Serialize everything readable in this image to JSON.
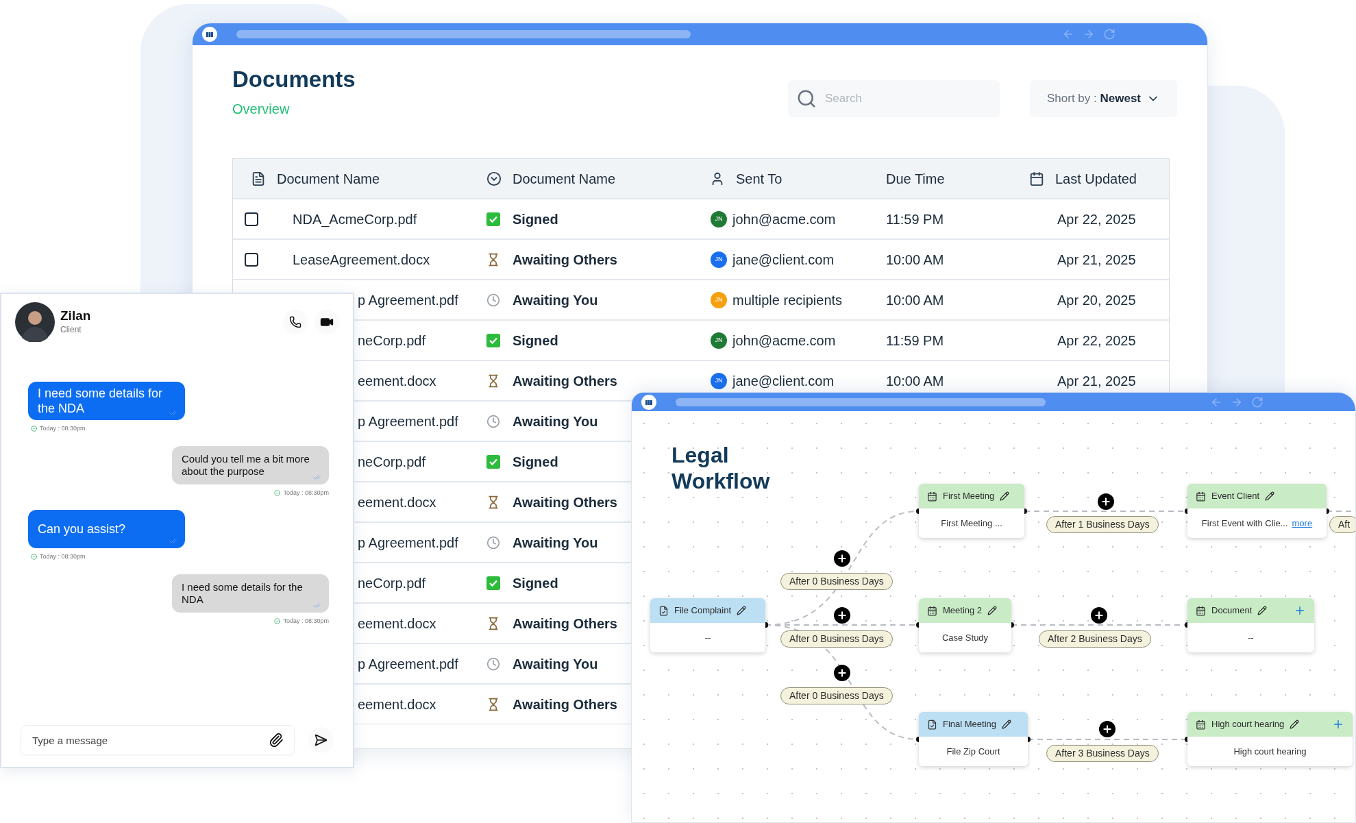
{
  "documents_window": {
    "title": "Documents",
    "subtitle": "Overview",
    "search": {
      "placeholder": "Search"
    },
    "sort": {
      "label": "Short by :",
      "value": "Newest"
    },
    "columns": [
      "Document Name",
      "Document Name",
      "Sent To",
      "Due Time",
      "Last Updated"
    ],
    "rows": [
      {
        "kind": "whole",
        "checked": false,
        "name": "NDA_AcmeCorp.pdf",
        "status": {
          "kind": "signed",
          "label": "Signed"
        },
        "recipient": {
          "initials": "JN",
          "color": "#1f7a35",
          "email": "john@acme.com"
        },
        "due": "11:59 PM",
        "updated": "Apr 22, 2025"
      },
      {
        "kind": "whole",
        "checked": false,
        "name": "LeaseAgreement.docx",
        "status": {
          "kind": "awaiting_others",
          "label": "Awaiting Others"
        },
        "recipient": {
          "initials": "JN",
          "color": "#1a6ff0",
          "email": "jane@client.com"
        },
        "due": "10:00 AM",
        "updated": "Apr 21, 2025"
      },
      {
        "kind": "covered",
        "name": "p Agreement.pdf",
        "status": {
          "kind": "awaiting_you",
          "label": "Awaiting You"
        },
        "recipient": {
          "initials": "JN",
          "color": "#f5a00f",
          "email": "multiple recipients"
        },
        "due": "10:00 AM",
        "updated": "Apr 20, 2025"
      },
      {
        "kind": "covered",
        "name": "neCorp.pdf",
        "status": {
          "kind": "signed",
          "label": "Signed"
        },
        "recipient": {
          "initials": "JN",
          "color": "#1f7a35",
          "email": "john@acme.com"
        },
        "due": "11:59 PM",
        "updated": "Apr 22, 2025"
      },
      {
        "kind": "covered",
        "name": "eement.docx",
        "status": {
          "kind": "awaiting_others",
          "label": "Awaiting Others"
        },
        "recipient": {
          "initials": "JN",
          "color": "#1a6ff0",
          "email": "jane@client.com"
        },
        "due": "10:00 AM",
        "updated": "Apr 21, 2025"
      },
      {
        "kind": "covered",
        "name": "p Agreement.pdf",
        "status": {
          "kind": "awaiting_you",
          "label": "Awaiting You"
        }
      },
      {
        "kind": "covered",
        "name": "neCorp.pdf",
        "status": {
          "kind": "signed",
          "label": "Signed"
        }
      },
      {
        "kind": "covered",
        "name": "eement.docx",
        "status": {
          "kind": "awaiting_others",
          "label": "Awaiting Others"
        }
      },
      {
        "kind": "covered",
        "name": "p Agreement.pdf",
        "status": {
          "kind": "awaiting_you",
          "label": "Awaiting You"
        }
      },
      {
        "kind": "covered",
        "name": "neCorp.pdf",
        "status": {
          "kind": "signed",
          "label": "Signed"
        }
      },
      {
        "kind": "covered",
        "name": "eement.docx",
        "status": {
          "kind": "awaiting_others",
          "label": "Awaiting Others"
        }
      },
      {
        "kind": "covered",
        "name": "p Agreement.pdf",
        "status": {
          "kind": "awaiting_you",
          "label": "Awaiting You"
        }
      },
      {
        "kind": "covered",
        "name": "eement.docx",
        "status": {
          "kind": "awaiting_others",
          "label": "Awaiting Others"
        }
      }
    ]
  },
  "chat": {
    "contact": {
      "name": "Zilan",
      "role": "Client"
    },
    "messages": [
      {
        "kind": "outgoing",
        "text": "I need some details for the NDA",
        "time": "Today : 08:30pm"
      },
      {
        "kind": "incoming",
        "text": "Could you tell me a bit more about the purpose",
        "time": "Today : 08:30pm"
      },
      {
        "kind": "outgoing",
        "text": "Can you assist?",
        "time": "Today : 08:30pm"
      },
      {
        "kind": "incoming",
        "text": "I need some details for the NDA",
        "time": "Today : 08:30pm"
      }
    ],
    "input": {
      "placeholder": "Type a message"
    }
  },
  "workflow": {
    "title": "Legal Workflow",
    "nodes": [
      {
        "kind": "document",
        "title": "File Complaint",
        "body": "--",
        "color": "#bcdff4",
        "addable": false
      },
      {
        "kind": "event",
        "title": "First Meeting",
        "body": "First Meeting ...",
        "color": "#c9ecc6",
        "addable": false
      },
      {
        "kind": "event",
        "title": "Event Client",
        "body": "First Event with Clie...",
        "link": "more",
        "color": "#c9ecc6",
        "addable": false
      },
      {
        "kind": "event",
        "title": "Meeting 2",
        "body": "Case Study",
        "color": "#c9ecc6",
        "addable": false
      },
      {
        "kind": "event",
        "title": "Document",
        "body": "--",
        "color": "#c9ecc6",
        "addable": true
      },
      {
        "kind": "document",
        "title": "Final Meeting",
        "body": "File Zip Court",
        "color": "#bcdff4",
        "addable": false
      },
      {
        "kind": "event",
        "title": "High court hearing",
        "body": "High court hearing",
        "color": "#c9ecc6",
        "addable": true
      }
    ],
    "delays": [
      "After 0 Business Days",
      "After 0 Business Days",
      "After 0 Business Days",
      "After 1 Business Days",
      "After 2 Business Days",
      "After 3 Business Days",
      "Aft"
    ]
  }
}
